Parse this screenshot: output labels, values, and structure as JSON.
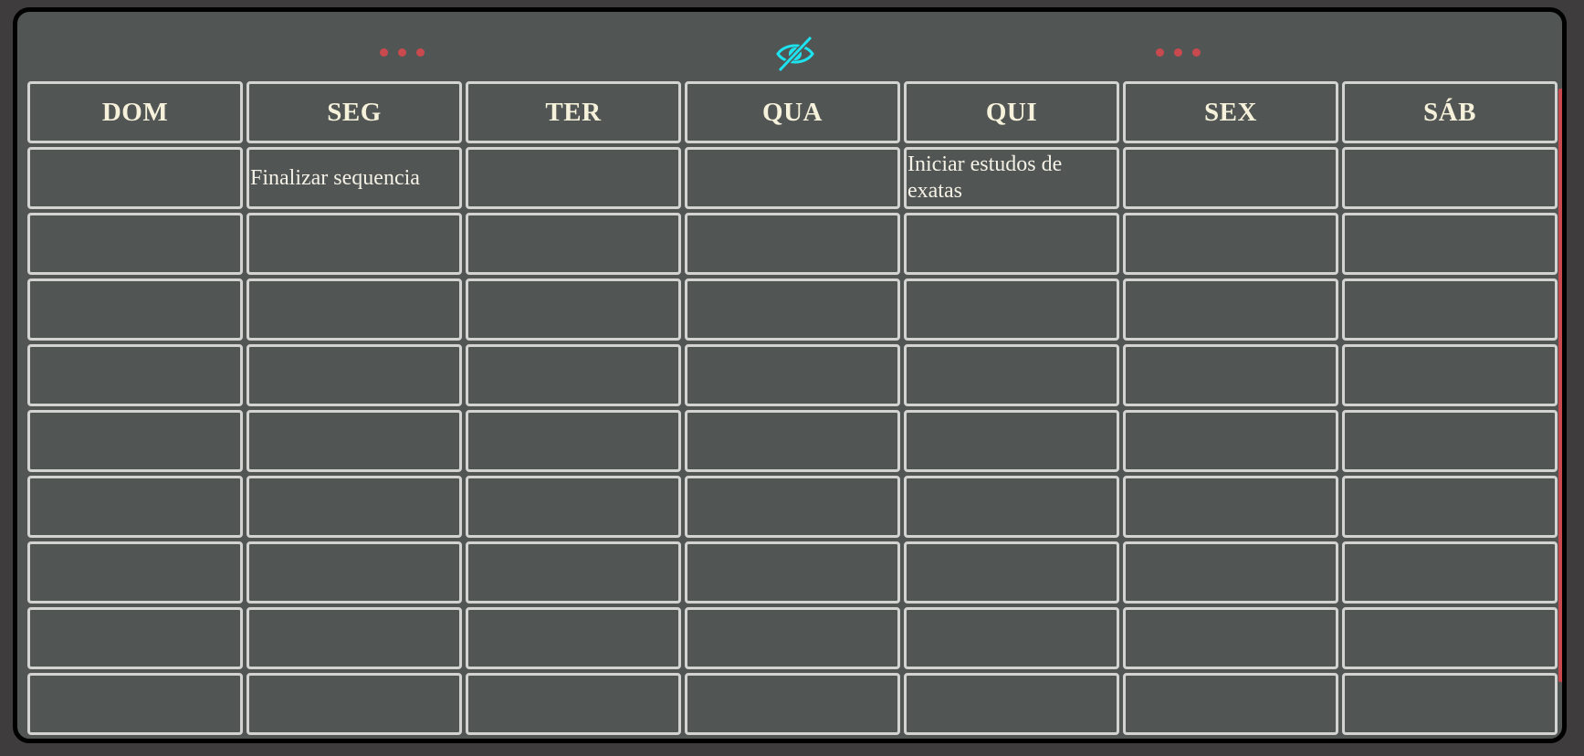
{
  "toolbar": {
    "left_menu_icon": "more-horizontal-icon",
    "right_menu_icon": "more-horizontal-icon",
    "visibility_icon": "eye-off-icon",
    "accent_color": "#c94a4e",
    "icon_color": "#1de3f0"
  },
  "calendar": {
    "weekdays": [
      "DOM",
      "SEG",
      "TER",
      "QUA",
      "QUI",
      "SEX",
      "SÁB"
    ],
    "rows": [
      [
        "",
        "Finalizar sequencia",
        "",
        "",
        "Iniciar estudos de exatas",
        "",
        ""
      ],
      [
        "",
        "",
        "",
        "",
        "",
        "",
        ""
      ],
      [
        "",
        "",
        "",
        "",
        "",
        "",
        ""
      ],
      [
        "",
        "",
        "",
        "",
        "",
        "",
        ""
      ],
      [
        "",
        "",
        "",
        "",
        "",
        "",
        ""
      ],
      [
        "",
        "",
        "",
        "",
        "",
        "",
        ""
      ],
      [
        "",
        "",
        "",
        "",
        "",
        "",
        ""
      ],
      [
        "",
        "",
        "",
        "",
        "",
        "",
        ""
      ],
      [
        "",
        "",
        "",
        "",
        "",
        "",
        ""
      ]
    ]
  }
}
